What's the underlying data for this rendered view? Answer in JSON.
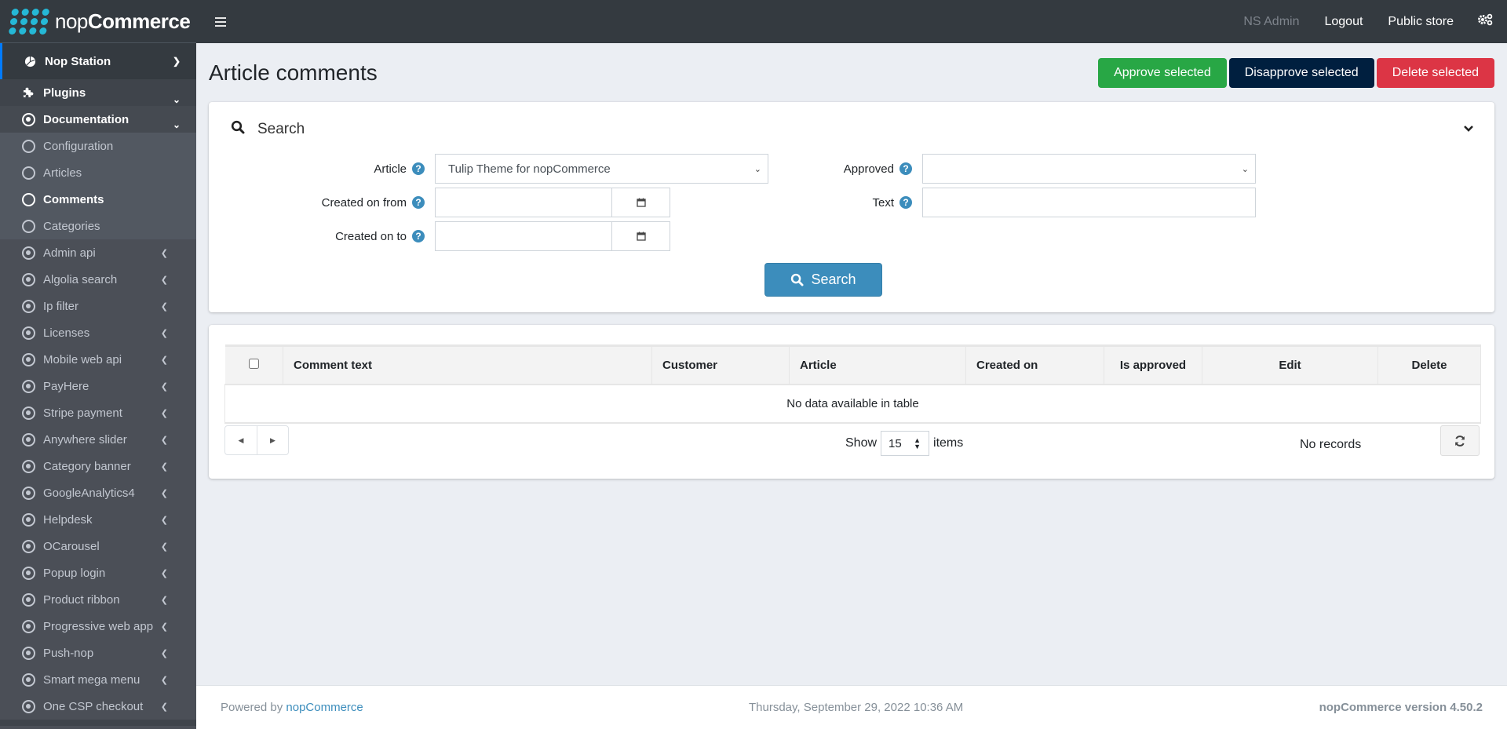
{
  "brand": {
    "light": "nop",
    "bold": "Commerce"
  },
  "sidebar": {
    "top": {
      "label": "Nop Station",
      "icon": "pie-chart-icon"
    },
    "plugins": {
      "label": "Plugins",
      "icon": "puzzle-icon"
    },
    "documentation": {
      "label": "Documentation",
      "children": [
        {
          "label": "Configuration",
          "active": false
        },
        {
          "label": "Articles",
          "active": false
        },
        {
          "label": "Comments",
          "active": true
        },
        {
          "label": "Categories",
          "active": false
        }
      ]
    },
    "items": [
      {
        "label": "Admin api"
      },
      {
        "label": "Algolia search"
      },
      {
        "label": "Ip filter"
      },
      {
        "label": "Licenses"
      },
      {
        "label": "Mobile web api"
      },
      {
        "label": "PayHere"
      },
      {
        "label": "Stripe payment"
      },
      {
        "label": "Anywhere slider"
      },
      {
        "label": "Category banner"
      },
      {
        "label": "GoogleAnalytics4"
      },
      {
        "label": "Helpdesk"
      },
      {
        "label": "OCarousel"
      },
      {
        "label": "Popup login"
      },
      {
        "label": "Product ribbon"
      },
      {
        "label": "Progressive web app"
      },
      {
        "label": "Push-nop"
      },
      {
        "label": "Smart mega menu"
      },
      {
        "label": "One CSP checkout"
      }
    ]
  },
  "header": {
    "user": "NS Admin",
    "logout": "Logout",
    "public_store": "Public store"
  },
  "page": {
    "title": "Article comments",
    "actions": {
      "approve": "Approve selected",
      "disapprove": "Disapprove selected",
      "delete": "Delete selected"
    }
  },
  "search": {
    "title": "Search",
    "article_label": "Article",
    "article_value": "Tulip Theme for nopCommerce",
    "created_from_label": "Created on from",
    "created_from_value": "",
    "created_to_label": "Created on to",
    "created_to_value": "",
    "approved_label": "Approved",
    "approved_value": "",
    "text_label": "Text",
    "text_value": "",
    "button": "Search",
    "help_glyph": "?"
  },
  "grid": {
    "columns": [
      "Comment text",
      "Customer",
      "Article",
      "Created on",
      "Is approved",
      "Edit",
      "Delete"
    ],
    "empty_message": "No data available in table",
    "show_label": "Show",
    "page_size": "15",
    "items_label": "items",
    "records": "No records"
  },
  "footer": {
    "powered_prefix": "Powered by",
    "powered_link": "nopCommerce",
    "datetime": "Thursday, September 29, 2022 10:36 AM",
    "version": "nopCommerce version 4.50.2"
  },
  "colors": {
    "approve": "#28a745",
    "disapprove": "#001f3f",
    "delete": "#dc3545",
    "primary": "#3c8dbc",
    "sidebar": "#4b4f57",
    "header": "#343a40"
  }
}
